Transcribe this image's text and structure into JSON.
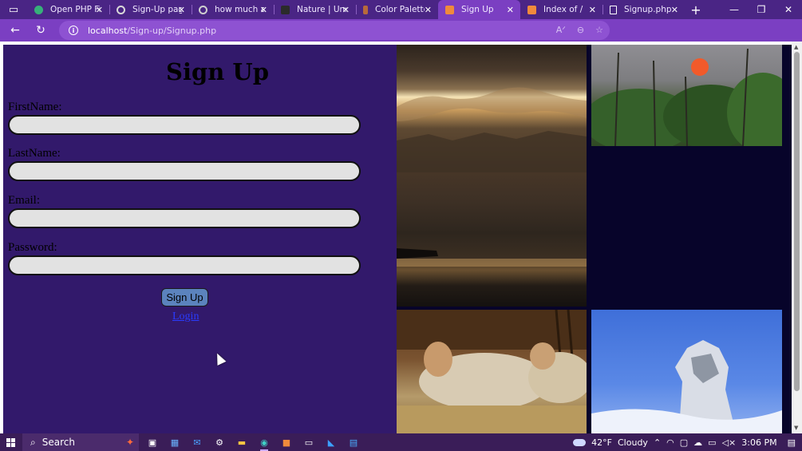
{
  "browser": {
    "tabs": [
      {
        "title": "Open PHP File",
        "favicon_color": "#37b07a",
        "active": false
      },
      {
        "title": "Sign-Up page",
        "favicon_color": "#d9d9d9",
        "active": false
      },
      {
        "title": "how much are",
        "favicon_color": "#cfcfcf",
        "active": false
      },
      {
        "title": "Nature | Unsplash",
        "favicon_color": "#2b2b2b",
        "active": false
      },
      {
        "title": "Color Palettes",
        "favicon_color": "#b86a3a",
        "active": false
      },
      {
        "title": "Sign Up",
        "favicon_color": "#f08a3c",
        "active": true
      },
      {
        "title": "Index of /",
        "favicon_color": "#f08a3c",
        "active": false
      },
      {
        "title": "Signup.php",
        "favicon_color": "#ffffff",
        "active": false
      }
    ],
    "url_host": "localhost",
    "url_path": "/Sign-up/Signup.php"
  },
  "form": {
    "title": "Sign Up",
    "fields": [
      {
        "label": "FirstName:",
        "value": ""
      },
      {
        "label": "LastName:",
        "value": ""
      },
      {
        "label": "Email:",
        "value": ""
      },
      {
        "label": "Password:",
        "value": ""
      }
    ],
    "submit_label": "Sign Up",
    "login_label": "Login"
  },
  "gallery": {
    "images": [
      {
        "subject": "sunset-over-lake"
      },
      {
        "subject": "sun-behind-trees"
      },
      {
        "subject": "sheep-in-barn"
      },
      {
        "subject": "snowy-rock-formation"
      }
    ]
  },
  "taskbar": {
    "search_label": "Search",
    "weather": "42°F",
    "weather_desc": "Cloudy",
    "time": "3:06 PM"
  },
  "colors": {
    "page_bg": "#32196b",
    "accent": "#7b3fc2",
    "button": "#5b83bd",
    "gallery_bg": "#07042a"
  }
}
